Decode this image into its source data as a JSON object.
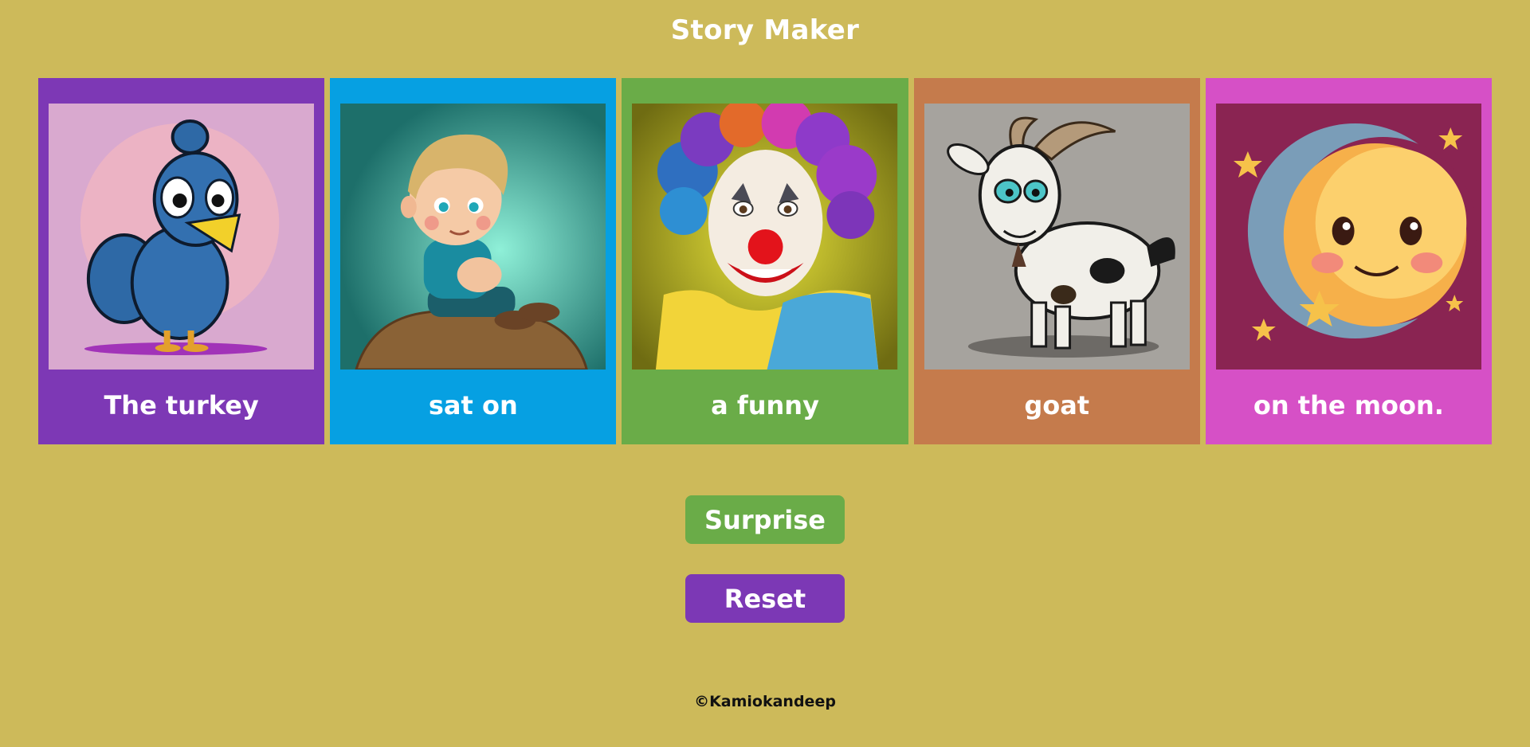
{
  "title": "Story Maker",
  "cards": [
    {
      "label": "The turkey",
      "image": "blue turkey cartoon",
      "color": "#7d38b5",
      "image_bg": "#d9a9cf"
    },
    {
      "label": "sat on",
      "image": "boy sitting on rock cartoon",
      "color": "#06a0e2",
      "image_bg": "#2d8f86"
    },
    {
      "label": "a funny",
      "image": "clown cartoon",
      "color": "#6aac48",
      "image_bg": "#b9b21a"
    },
    {
      "label": "goat",
      "image": "goat cartoon",
      "color": "#c57b4c",
      "image_bg": "#a6a39e"
    },
    {
      "label": "on the moon.",
      "image": "smiling crescent moon cartoon",
      "color": "#d650c6",
      "image_bg": "#8a2452"
    }
  ],
  "buttons": {
    "surprise_label": "Surprise",
    "reset_label": "Reset"
  },
  "footer": "©Kamiokandeep",
  "colors": {
    "background": "#cdba5a",
    "surprise_button": "#6aac48",
    "reset_button": "#7c38b5"
  }
}
